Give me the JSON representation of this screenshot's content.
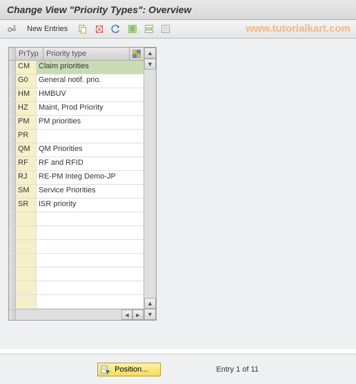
{
  "header": {
    "title": "Change View \"Priority Types\": Overview"
  },
  "toolbar": {
    "new_entries_label": "New Entries"
  },
  "watermark": "www.tutorialkart.com",
  "table": {
    "columns": {
      "code": "PrTyp",
      "name": "Priority type"
    },
    "rows": [
      {
        "code": "CM",
        "name": "Claim priorities",
        "selected": true
      },
      {
        "code": "G0",
        "name": "General notif. prio."
      },
      {
        "code": "HM",
        "name": "HMBUV"
      },
      {
        "code": "HZ",
        "name": "Maint, Prod Priority"
      },
      {
        "code": "PM",
        "name": "PM priorities"
      },
      {
        "code": "PR",
        "name": ""
      },
      {
        "code": "QM",
        "name": "QM Priorities"
      },
      {
        "code": "RF",
        "name": "RF and RFID"
      },
      {
        "code": "RJ",
        "name": "RE-PM Integ Demo-JP"
      },
      {
        "code": "SM",
        "name": "Service Priorities"
      },
      {
        "code": "SR",
        "name": "ISR priority"
      }
    ],
    "empty_row_count": 7
  },
  "footer": {
    "position_label": "Position...",
    "entry_status": "Entry 1 of 11"
  }
}
